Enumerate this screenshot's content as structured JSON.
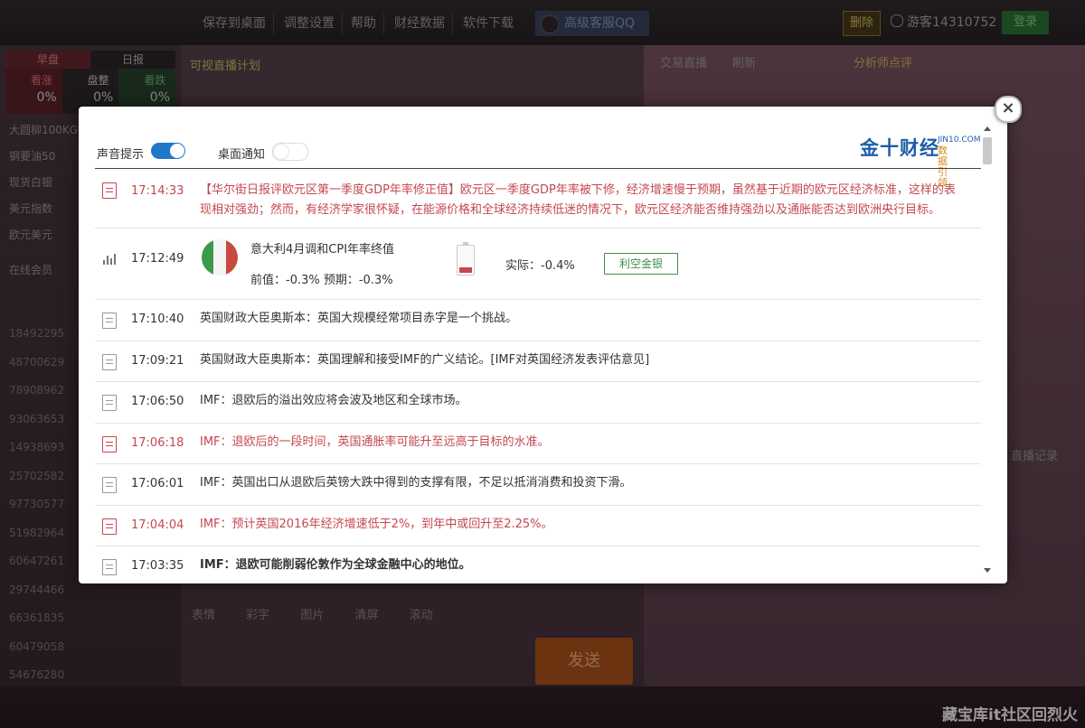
{
  "topbar": {
    "nav": [
      "保存到桌面",
      "调整设置",
      "帮助",
      "财经数据",
      "软件下载"
    ],
    "kefu_label": "高级客服QQ",
    "vip_label": "删除",
    "guest_label": "游客14310752",
    "login_label": "登录"
  },
  "left_panel": {
    "tab_a": "早盘",
    "tab_b": "日报",
    "stats": [
      {
        "name": "看涨",
        "pct": "0%"
      },
      {
        "name": "盘整",
        "pct": "0%"
      },
      {
        "name": "看跌",
        "pct": "0%"
      }
    ],
    "list": [
      "大圆柳100KG",
      "钢要油50",
      "现货白银",
      "美元指数",
      "欧元美元"
    ],
    "online_label": "在线会员",
    "ids": [
      "18492295",
      "48700629",
      "78908962",
      "93063653",
      "14938693",
      "25702582",
      "97730577",
      "51982964",
      "60647261",
      "29744466",
      "66361835",
      "60479058",
      "54676280"
    ]
  },
  "mid_panel": {
    "head": "可视直播计划",
    "toolbar": [
      "表情",
      "彩字",
      "图片",
      "清屏",
      "滚动"
    ],
    "send_label": "发送"
  },
  "right_panel": {
    "tabs": [
      "交易直播",
      "刷新",
      "分析师点评"
    ],
    "misc": "直播记录"
  },
  "footer": {
    "text": "藏宝库it社区回烈火"
  },
  "modal": {
    "sound_label": "声音提示",
    "sound_on": true,
    "desktop_label": "桌面通知",
    "desktop_on": false,
    "brand_main": "金十财经",
    "brand_sub": "JIN10.COM",
    "brand_sub2": "数据引领",
    "close_symbol": "×",
    "feed": [
      {
        "time": "17:14:33",
        "text": "【华尔街日报评欧元区第一季度GDP年率修正值】欧元区一季度GDP年率被下修，经济增速慢于预期，虽然基于近期的欧元区经济标准，这样的表现相对强劲；然而，有经济学家很怀疑，在能源价格和全球经济持续低迷的情况下，欧元区经济能否维持强劲以及通胀能否达到欧洲央行目标。",
        "color": "red"
      },
      {
        "time": "17:12:49",
        "type": "data",
        "title": "意大利4月调和CPI年率终值",
        "prev": "前值：-0.3% 预期：-0.3%",
        "actual": "实际：-0.4%",
        "impact": "利空金银"
      },
      {
        "time": "17:10:40",
        "text": "英国财政大臣奥斯本：英国大规模经常项目赤字是一个挑战。",
        "color": "normal"
      },
      {
        "time": "17:09:21",
        "text": "英国财政大臣奥斯本：英国理解和接受IMF的广义结论。[IMF对英国经济发表评估意见]",
        "color": "normal"
      },
      {
        "time": "17:06:50",
        "text": "IMF：退欧后的溢出效应将会波及地区和全球市场。",
        "color": "normal"
      },
      {
        "time": "17:06:18",
        "text": "IMF：退欧后的一段时间，英国通胀率可能升至远高于目标的水准。",
        "color": "red"
      },
      {
        "time": "17:06:01",
        "text": "IMF：英国出口从退欧后英镑大跌中得到的支撑有限，不足以抵消消费和投资下滑。",
        "color": "normal"
      },
      {
        "time": "17:04:04",
        "text": "IMF：预计英国2016年经济增速低于2%，到年中或回升至2.25%。",
        "color": "red"
      },
      {
        "time": "17:03:35",
        "text": "IMF：退欧可能削弱伦敦作为全球金融中心的地位。",
        "color": "bold"
      }
    ]
  },
  "colors": {
    "accent_red": "#c5474f",
    "switch_on": "#2178c8",
    "brand_blue": "#1d5ea6",
    "impact_green": "#3f8f4f",
    "flag_green": "#3a9a4a",
    "flag_red": "#c84a3f"
  }
}
